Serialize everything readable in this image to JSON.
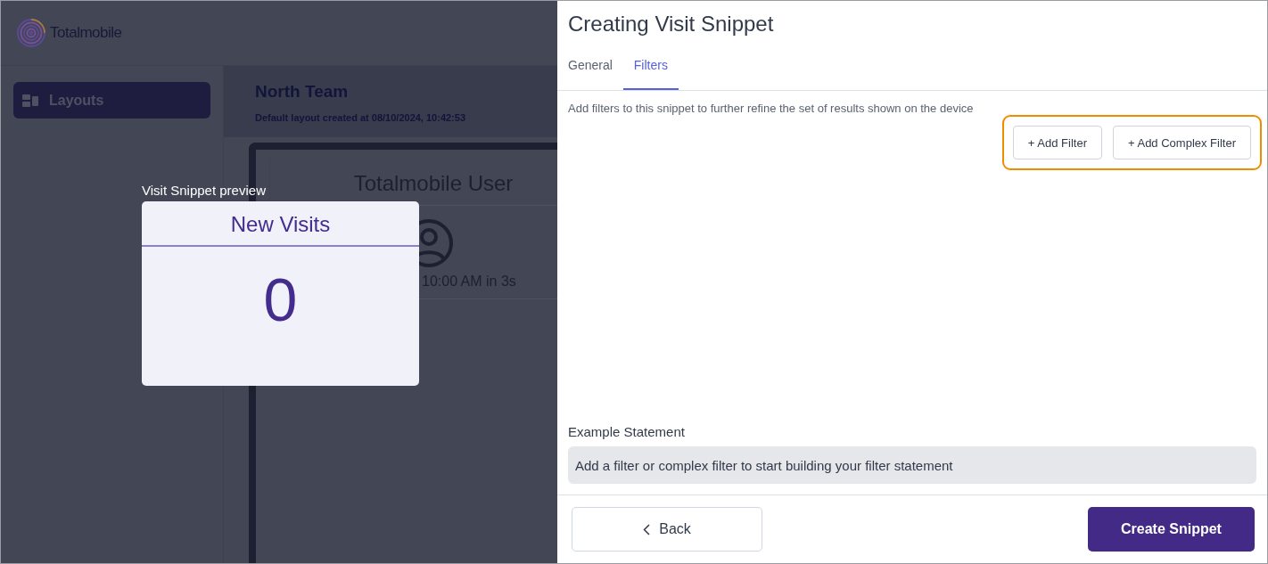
{
  "app": {
    "logo_text": "Totalmobile",
    "sidebar": {
      "items": [
        {
          "label": "Layouts",
          "selected": true
        }
      ]
    },
    "layout_header": {
      "title": "North Team",
      "subtitle": "Default layout created at 08/10/2024, 10:42:53"
    },
    "device_card": {
      "title": "Totalmobile User",
      "time": "10:00 AM in 3s"
    }
  },
  "preview": {
    "label": "Visit Snippet preview",
    "title": "New Visits",
    "value": "0"
  },
  "dialog": {
    "title": "Creating Visit Snippet",
    "tabs": [
      {
        "label": "General",
        "selected": false
      },
      {
        "label": "Filters",
        "selected": true
      }
    ],
    "description": "Add filters to this snippet to further refine the set of results shown on the device",
    "filter_buttons": [
      "+ Add Filter",
      "+ Add Complex Filter"
    ],
    "example_label": "Example Statement",
    "example_text": "Add a filter or complex filter to start building your filter statement",
    "back_button": "Back",
    "create_button": "Create Snippet"
  }
}
